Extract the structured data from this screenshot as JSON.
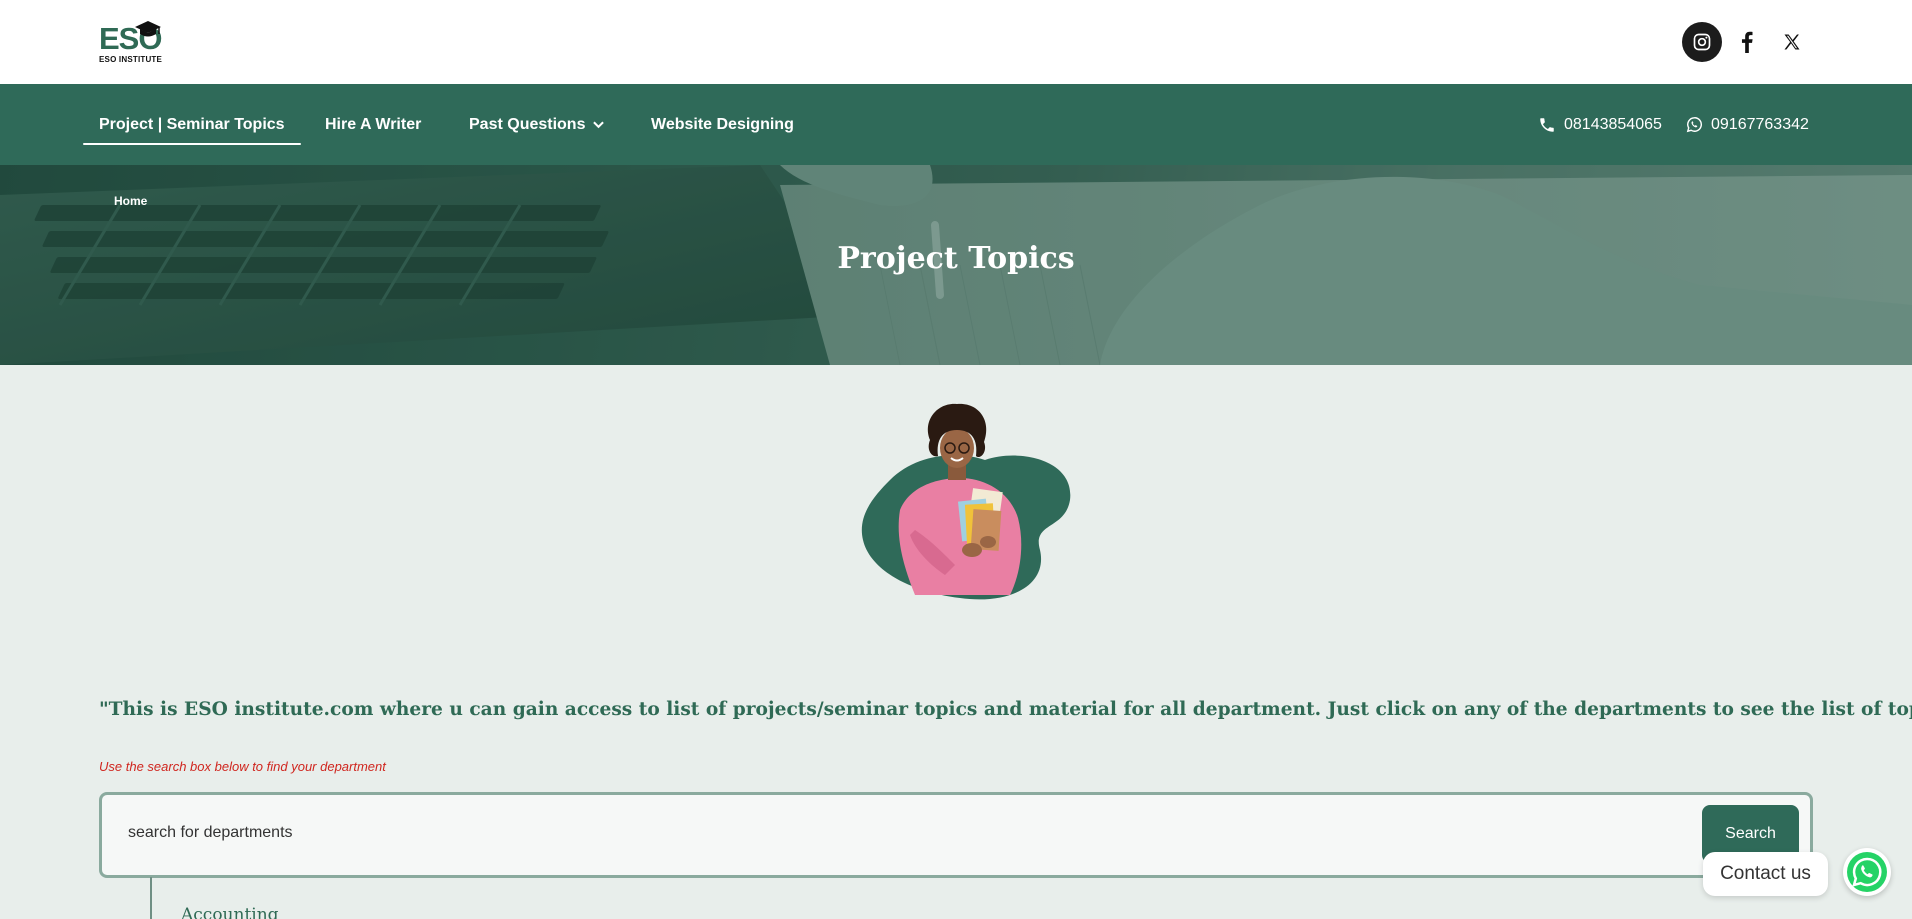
{
  "logo": {
    "brand": "ESO",
    "subtitle": "ESO INSTITUTE"
  },
  "social": {
    "instagram": "instagram-icon",
    "facebook": "facebook-icon",
    "x": "x-icon"
  },
  "nav": {
    "items": [
      {
        "label": "Project | Seminar Topics",
        "active": true
      },
      {
        "label": "Hire A Writer"
      },
      {
        "label": "Past Questions",
        "has_dropdown": true
      },
      {
        "label": "Website Designing"
      }
    ],
    "phone": "08143854065",
    "whatsapp": "09167763342"
  },
  "hero": {
    "breadcrumb": "Home",
    "title": "Project Topics"
  },
  "main": {
    "quote": "\"This is ESO institute.com where u can gain access to list of projects/seminar topics and material for all department. Just click on any of the departments to see the list of topics\"",
    "hint": "Use the search box below to find your department",
    "search": {
      "placeholder": "search for departments",
      "button_label": "Search"
    },
    "departments": [
      "Accounting"
    ]
  },
  "contact_widget": {
    "label": "Contact us"
  },
  "colors": {
    "primary": "#2f6a59",
    "hint": "#d0261f",
    "background": "#e8eeeb"
  }
}
